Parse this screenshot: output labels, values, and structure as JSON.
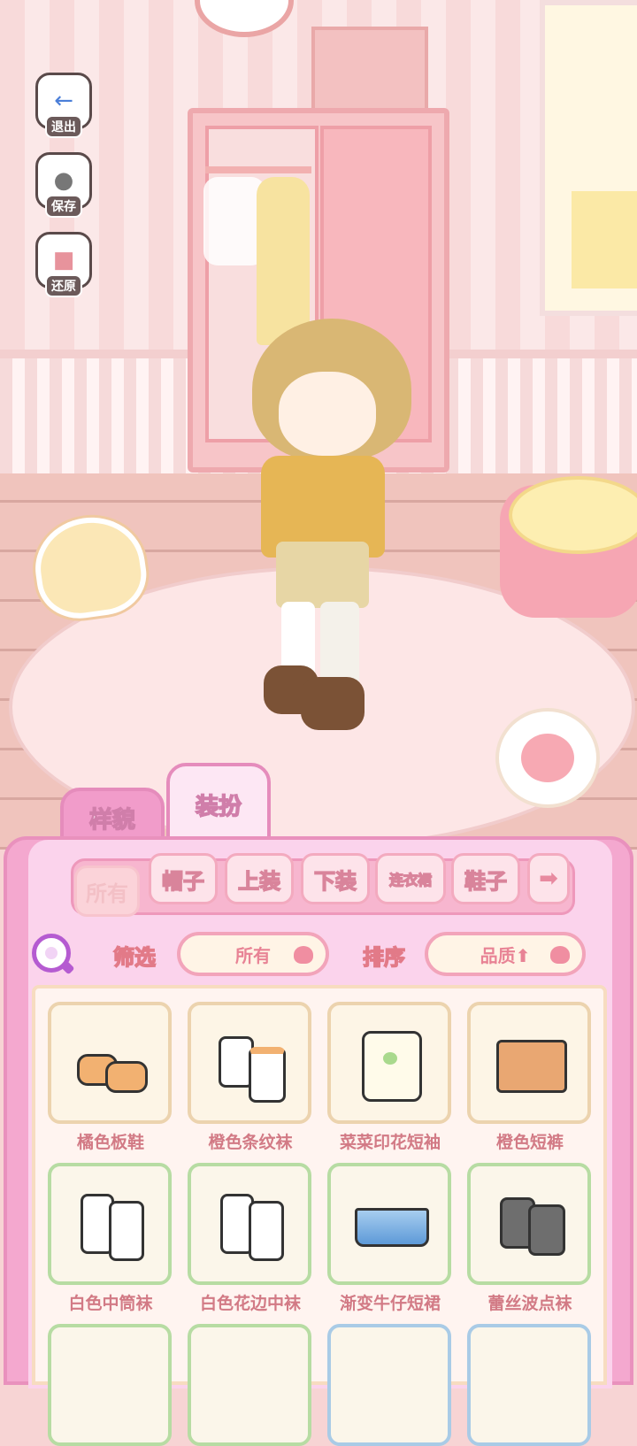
{
  "side_buttons": [
    {
      "label": "退出",
      "icon": "exit-arrow-icon"
    },
    {
      "label": "保存",
      "icon": "save-cat-icon"
    },
    {
      "label": "还原",
      "icon": "restore-icon"
    }
  ],
  "main_tabs": [
    {
      "label": "样貌",
      "active": false
    },
    {
      "label": "装扮",
      "active": true
    }
  ],
  "categories": [
    {
      "label": "所有",
      "active": true
    },
    {
      "label": "帽子"
    },
    {
      "label": "上装"
    },
    {
      "label": "下装"
    },
    {
      "label": "连衣裙"
    },
    {
      "label": "鞋子"
    }
  ],
  "category_next_icon": "arrow-right-icon",
  "category_next_glyph": "➡",
  "filter": {
    "label": "筛选",
    "value": "所有"
  },
  "sort": {
    "label": "排序",
    "value": "品质⬆"
  },
  "items": [
    {
      "name": "橘色板鞋",
      "rarity": "tan"
    },
    {
      "name": "橙色条纹袜",
      "rarity": "tan"
    },
    {
      "name": "菜菜印花短袖",
      "rarity": "tan"
    },
    {
      "name": "橙色短裤",
      "rarity": "tan"
    },
    {
      "name": "白色中筒袜",
      "rarity": "green"
    },
    {
      "name": "白色花边中袜",
      "rarity": "green"
    },
    {
      "name": "渐变牛仔短裙",
      "rarity": "green"
    },
    {
      "name": "蕾丝波点袜",
      "rarity": "green"
    },
    {
      "name": "",
      "rarity": "green"
    },
    {
      "name": "",
      "rarity": "green"
    },
    {
      "name": "",
      "rarity": "blue"
    },
    {
      "name": "",
      "rarity": "blue"
    }
  ],
  "colors": {
    "panel": "#f4a8cf",
    "accent_text": "#d27a85",
    "search": "#b55bd1"
  }
}
